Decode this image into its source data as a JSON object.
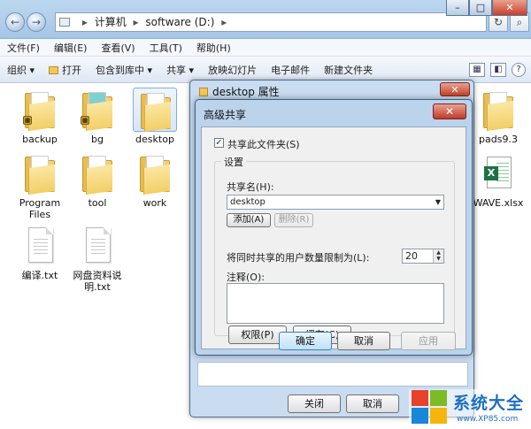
{
  "explorer": {
    "address": {
      "segments": [
        "计算机",
        "software (D:)"
      ]
    },
    "menu": [
      "文件(F)",
      "编辑(E)",
      "查看(V)",
      "工具(T)",
      "帮助(H)"
    ],
    "toolbar": [
      "组织 ▾",
      "打开",
      "包含到库中 ▾",
      "共享 ▾",
      "放映幻灯片",
      "电子邮件",
      "新建文件夹"
    ],
    "files": [
      {
        "name": "backup",
        "type": "folder",
        "locked": true
      },
      {
        "name": "bg",
        "type": "folder",
        "locked": true
      },
      {
        "name": "desktop",
        "type": "folder",
        "selected": true
      },
      {
        "name": "pads9.3",
        "type": "folder"
      },
      {
        "name": "Program Files",
        "type": "folder"
      },
      {
        "name": "tool",
        "type": "folder"
      },
      {
        "name": "work",
        "type": "folder"
      },
      {
        "name": "WAVE.xlsx",
        "type": "excel"
      },
      {
        "name": "编译.txt",
        "type": "text"
      },
      {
        "name": "网盘资料说明.txt",
        "type": "text"
      }
    ]
  },
  "properties_dialog": {
    "title": "desktop 属性",
    "close_label": "关闭",
    "cancel_label": "取消"
  },
  "advanced_sharing": {
    "title": "高级共享",
    "share_checkbox_label": "共享此文件夹(S)",
    "share_checked": true,
    "settings_legend": "设置",
    "share_name_label": "共享名(H):",
    "share_name_value": "desktop",
    "add_label": "添加(A)",
    "remove_label": "删除(R)",
    "user_limit_label": "将同时共享的用户数量限制为(L):",
    "user_limit_value": "20",
    "comment_label": "注释(O):",
    "permissions_label": "权限(P)",
    "cache_label": "缓存(C)",
    "ok_label": "确定",
    "cancel_label": "取消",
    "apply_label": "应用"
  },
  "watermark": {
    "title": "系统大全",
    "url": "www.XP85.com",
    "colors": [
      "#e8412c",
      "#7cbb27",
      "#1a86d8",
      "#f5b50c"
    ]
  },
  "icons": {
    "back": "←",
    "forward": "→",
    "up": "▲",
    "down": "▼",
    "dropdown": "▼",
    "check": "✓",
    "close": "✕"
  }
}
